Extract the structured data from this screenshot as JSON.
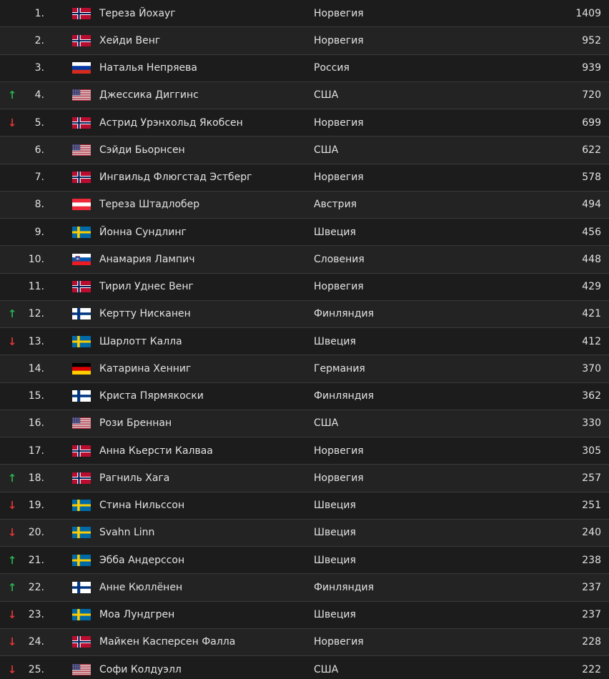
{
  "colors": {
    "up": "#27b14f",
    "down": "#e23434",
    "text": "#e2e2e2",
    "background": "#1f1f1f",
    "separator": "#3a3a3a"
  },
  "icons": {
    "up": "↑",
    "down": "↓"
  },
  "rows": [
    {
      "rank": "1.",
      "flag": "norway",
      "name": "Тереза Йохауг",
      "country": "Норвегия",
      "points": "1409",
      "trend": "none"
    },
    {
      "rank": "2.",
      "flag": "norway",
      "name": "Хейди Венг",
      "country": "Норвегия",
      "points": "952",
      "trend": "none"
    },
    {
      "rank": "3.",
      "flag": "russia",
      "name": "Наталья Непряева",
      "country": "Россия",
      "points": "939",
      "trend": "none"
    },
    {
      "rank": "4.",
      "flag": "usa",
      "name": "Джессика Диггинс",
      "country": "США",
      "points": "720",
      "trend": "up"
    },
    {
      "rank": "5.",
      "flag": "norway",
      "name": "Астрид Урэнхольд Якобсен",
      "country": "Норвегия",
      "points": "699",
      "trend": "down"
    },
    {
      "rank": "6.",
      "flag": "usa",
      "name": "Сэйди Бьорнсен",
      "country": "США",
      "points": "622",
      "trend": "none"
    },
    {
      "rank": "7.",
      "flag": "norway",
      "name": "Ингвильд Флюгстад Эстберг",
      "country": "Норвегия",
      "points": "578",
      "trend": "none"
    },
    {
      "rank": "8.",
      "flag": "austria",
      "name": "Тереза Штадлобер",
      "country": "Австрия",
      "points": "494",
      "trend": "none"
    },
    {
      "rank": "9.",
      "flag": "sweden",
      "name": "Йонна Сундлинг",
      "country": "Швеция",
      "points": "456",
      "trend": "none"
    },
    {
      "rank": "10.",
      "flag": "slovenia",
      "name": "Анамария Лампич",
      "country": "Словения",
      "points": "448",
      "trend": "none"
    },
    {
      "rank": "11.",
      "flag": "norway",
      "name": "Тирил Уднес Венг",
      "country": "Норвегия",
      "points": "429",
      "trend": "none"
    },
    {
      "rank": "12.",
      "flag": "finland",
      "name": "Кертту Нисканен",
      "country": "Финляндия",
      "points": "421",
      "trend": "up"
    },
    {
      "rank": "13.",
      "flag": "sweden",
      "name": "Шарлотт Калла",
      "country": "Швеция",
      "points": "412",
      "trend": "down"
    },
    {
      "rank": "14.",
      "flag": "germany",
      "name": "Катарина Хенниг",
      "country": "Германия",
      "points": "370",
      "trend": "none"
    },
    {
      "rank": "15.",
      "flag": "finland",
      "name": "Криста Пярмякоски",
      "country": "Финляндия",
      "points": "362",
      "trend": "none"
    },
    {
      "rank": "16.",
      "flag": "usa",
      "name": "Рози Бреннан",
      "country": "США",
      "points": "330",
      "trend": "none"
    },
    {
      "rank": "17.",
      "flag": "norway",
      "name": "Анна Кьерсти Калваа",
      "country": "Норвегия",
      "points": "305",
      "trend": "none"
    },
    {
      "rank": "18.",
      "flag": "norway",
      "name": "Рагниль Хага",
      "country": "Норвегия",
      "points": "257",
      "trend": "up"
    },
    {
      "rank": "19.",
      "flag": "sweden",
      "name": "Стина Нильссон",
      "country": "Швеция",
      "points": "251",
      "trend": "down"
    },
    {
      "rank": "20.",
      "flag": "sweden",
      "name": "Svahn Linn",
      "country": "Швеция",
      "points": "240",
      "trend": "down"
    },
    {
      "rank": "21.",
      "flag": "sweden",
      "name": "Эбба Андерссон",
      "country": "Швеция",
      "points": "238",
      "trend": "up"
    },
    {
      "rank": "22.",
      "flag": "finland",
      "name": "Анне Кюллёнен",
      "country": "Финляндия",
      "points": "237",
      "trend": "up"
    },
    {
      "rank": "23.",
      "flag": "sweden",
      "name": "Моа Лундгрен",
      "country": "Швеция",
      "points": "237",
      "trend": "down"
    },
    {
      "rank": "24.",
      "flag": "norway",
      "name": "Майкен Касперсен Фалла",
      "country": "Норвегия",
      "points": "228",
      "trend": "down"
    },
    {
      "rank": "25.",
      "flag": "usa",
      "name": "Софи Колдуэлл",
      "country": "США",
      "points": "222",
      "trend": "down"
    }
  ]
}
